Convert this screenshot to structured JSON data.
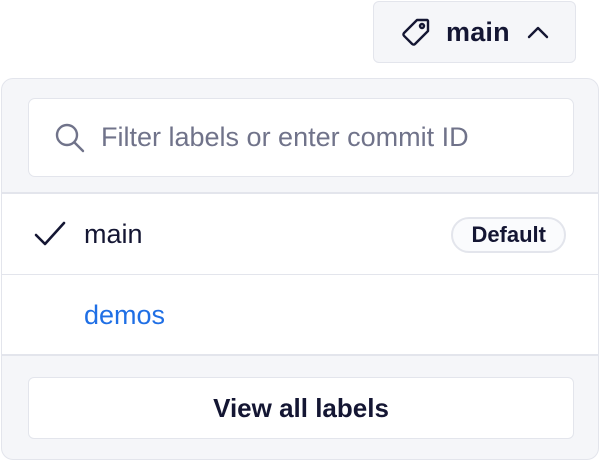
{
  "branch_selector": {
    "current_label": "main",
    "icon": "tag-icon",
    "toggle_icon": "chevron-up-icon"
  },
  "dropdown": {
    "search": {
      "placeholder": "Filter labels or enter commit ID",
      "value": "",
      "icon": "search-icon"
    },
    "items": [
      {
        "label": "main",
        "selected": true,
        "badge": "Default"
      },
      {
        "label": "demos",
        "selected": false
      }
    ],
    "footer_button": "View all labels"
  },
  "colors": {
    "text": "#141633",
    "link": "#1f6fe5",
    "panel_bg": "#f5f6f9",
    "border": "#e3e5ec",
    "placeholder": "#70738a"
  }
}
